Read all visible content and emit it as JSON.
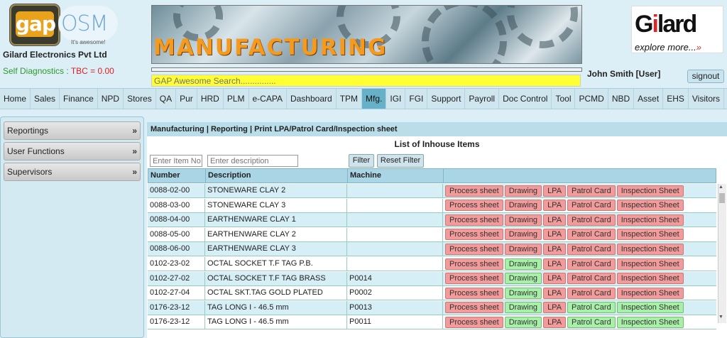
{
  "brand": {
    "logo_text": "gap",
    "osm_text": "OSM",
    "tagline": "It's awesome!",
    "company": "Gilard Electronics Pvt Ltd",
    "diagnostics_label": "Self Diagnostics : ",
    "diagnostics_value": "TBC = 0.00"
  },
  "banner": {
    "text": "MANUFACTURING"
  },
  "search": {
    "placeholder": "GAP Awesome Search..............."
  },
  "user": {
    "name": "John Smith [User]",
    "signout": "signout"
  },
  "partner": {
    "name_pre": "G",
    "name_i": "i",
    "name_post": "lard",
    "tag": "explore more...",
    "tag_arrow": "»"
  },
  "nav": [
    "Home",
    "Sales",
    "Finance",
    "NPD",
    "Stores",
    "QA",
    "Pur",
    "HRD",
    "PLM",
    "e-CAPA",
    "Dashboard",
    "TPM",
    "Mfg.",
    "IGI",
    "FGI",
    "Support",
    "Payroll",
    "Doc Control",
    "Tool",
    "PCMD",
    "NBD",
    "Asset",
    "EHS",
    "Visitors"
  ],
  "nav_active": "Mfg.",
  "sidebar": [
    {
      "label": "Reportings",
      "arrow": "»"
    },
    {
      "label": "User Functions",
      "arrow": "»"
    },
    {
      "label": "Supervisors",
      "arrow": "»"
    }
  ],
  "breadcrumb": "Manufacturing | Reporting | Print LPA/Patrol Card/Inspection sheet",
  "list_title": "List of Inhouse Items",
  "filters": {
    "item_no_placeholder": "Enter Item No",
    "desc_placeholder": "Enter description",
    "filter_btn": "Filter",
    "reset_btn": "Reset Filter"
  },
  "columns": [
    "Number",
    "Description",
    "Machine",
    ""
  ],
  "actions": [
    "Process sheet",
    "Drawing",
    "LPA",
    "Patrol Card",
    "Inspection Sheet"
  ],
  "colors": {
    "red": "#f39a9a",
    "green": "#a8f0a8"
  },
  "rows": [
    {
      "number": "0088-02-00",
      "desc": "STONEWARE CLAY 2",
      "machine": "",
      "status": [
        "red",
        "red",
        "red",
        "red",
        "red"
      ]
    },
    {
      "number": "0088-03-00",
      "desc": "STONEWARE CLAY 3",
      "machine": "",
      "status": [
        "red",
        "red",
        "red",
        "red",
        "red"
      ]
    },
    {
      "number": "0088-04-00",
      "desc": "EARTHENWARE CLAY 1",
      "machine": "",
      "status": [
        "red",
        "red",
        "red",
        "red",
        "red"
      ]
    },
    {
      "number": "0088-05-00",
      "desc": "EARTHENWARE CLAY 2",
      "machine": "",
      "status": [
        "red",
        "red",
        "red",
        "red",
        "red"
      ]
    },
    {
      "number": "0088-06-00",
      "desc": "EARTHENWARE CLAY 3",
      "machine": "",
      "status": [
        "red",
        "red",
        "red",
        "red",
        "red"
      ]
    },
    {
      "number": "0102-23-02",
      "desc": "OCTAL SOCKET T.F TAG P.B.",
      "machine": "",
      "status": [
        "red",
        "green",
        "red",
        "red",
        "red"
      ]
    },
    {
      "number": "0102-27-02",
      "desc": "OCTAL SOCKET T.F TAG BRASS",
      "machine": "P0014",
      "status": [
        "red",
        "green",
        "red",
        "red",
        "red"
      ]
    },
    {
      "number": "0102-27-04",
      "desc": "OCTAL SKT.TAG GOLD PLATED",
      "machine": "P0002",
      "status": [
        "red",
        "green",
        "red",
        "red",
        "red"
      ]
    },
    {
      "number": "0176-23-12",
      "desc": "TAG LONG I - 46.5 mm",
      "machine": "P0013",
      "status": [
        "red",
        "green",
        "red",
        "green",
        "green"
      ]
    },
    {
      "number": "0176-23-12",
      "desc": "TAG LONG I - 46.5 mm",
      "machine": "P0011",
      "status": [
        "red",
        "green",
        "red",
        "green",
        "green"
      ]
    }
  ]
}
